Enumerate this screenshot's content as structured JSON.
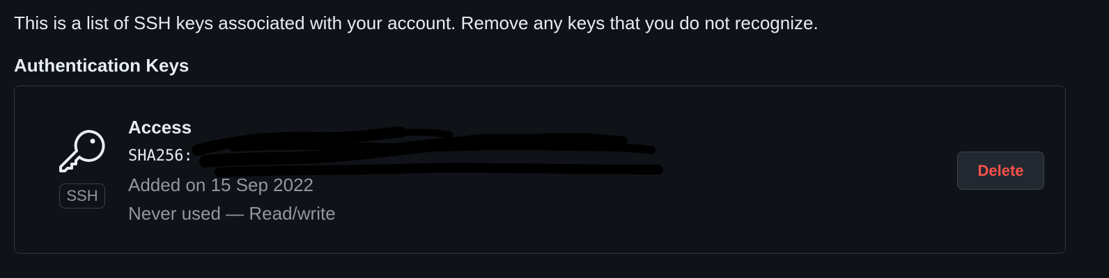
{
  "intro_text": "This is a list of SSH keys associated with your account. Remove any keys that you do not recognize.",
  "section_title": "Authentication Keys",
  "ssh_key": {
    "icon": "key-icon",
    "type_badge": "SSH",
    "title": "Access",
    "fingerprint_prefix": "SHA256:",
    "added_on": "Added on 15 Sep 2022",
    "usage": "Never used — Read/write",
    "delete_label": "Delete"
  },
  "colors": {
    "background": "#0f1217",
    "card_border": "#30363d",
    "primary_text": "#e6edf3",
    "muted_text": "#9198a1",
    "danger": "#f85149",
    "button_bg": "#212830"
  }
}
